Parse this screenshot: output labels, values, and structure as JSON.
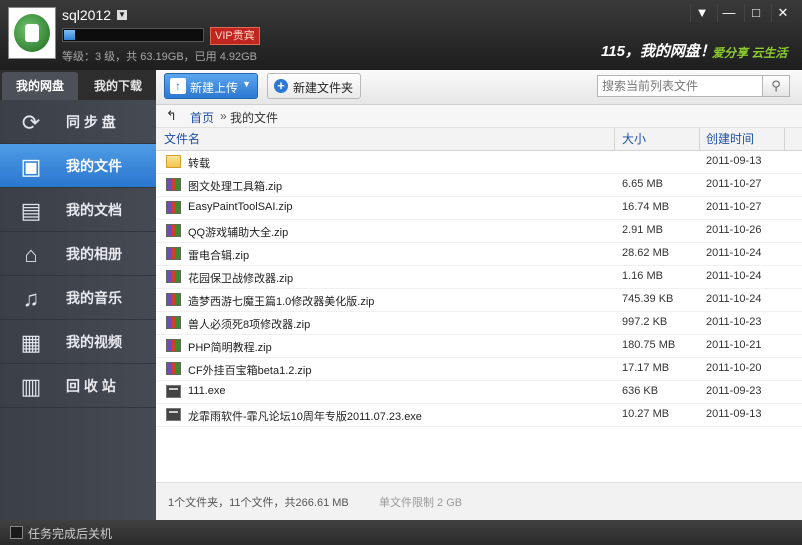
{
  "user": {
    "name": "sql2012",
    "vip_label": "VIP贵宾",
    "level_text": "等级：3 级，共 63.19GB，已用 4.92GB",
    "usage_fraction": 0.078
  },
  "brand": {
    "logo": "115，我的网盘！",
    "slogan": "爱分享 云生活"
  },
  "window_controls": {
    "menu": "▼",
    "minimize": "—",
    "maximize": "□",
    "close": "✕"
  },
  "nav": {
    "tabs": [
      {
        "label": "我的网盘",
        "active": true
      },
      {
        "label": "我的下载",
        "active": false
      }
    ],
    "items": [
      {
        "label": "同 步 盘",
        "icon": "sync-icon",
        "glyph": "⟳",
        "active": false
      },
      {
        "label": "我的文件",
        "icon": "briefcase-icon",
        "glyph": "▣",
        "active": true
      },
      {
        "label": "我的文档",
        "icon": "document-icon",
        "glyph": "▤",
        "active": false
      },
      {
        "label": "我的相册",
        "icon": "photo-album-icon",
        "glyph": "⌂",
        "active": false
      },
      {
        "label": "我的音乐",
        "icon": "music-note-icon",
        "glyph": "♫",
        "active": false
      },
      {
        "label": "我的视频",
        "icon": "film-icon",
        "glyph": "▦",
        "active": false
      },
      {
        "label": "回 收 站",
        "icon": "trash-icon",
        "glyph": "▥",
        "active": false
      }
    ]
  },
  "toolbar": {
    "upload_label": "新建上传",
    "new_folder_label": "新建文件夹",
    "search_placeholder": "搜索当前列表文件"
  },
  "breadcrumb": {
    "home": "首页",
    "separator": "»",
    "current": "我的文件"
  },
  "table": {
    "headers": {
      "name": "文件名",
      "size": "大小",
      "date": "创建时间"
    },
    "rows": [
      {
        "type": "folder",
        "name": "转载",
        "size": "",
        "date": "2011-09-13"
      },
      {
        "type": "zip",
        "name": "图文处理工具箱.zip",
        "size": "6.65 MB",
        "date": "2011-10-27"
      },
      {
        "type": "zip",
        "name": "EasyPaintToolSAI.zip",
        "size": "16.74 MB",
        "date": "2011-10-27"
      },
      {
        "type": "zip",
        "name": "QQ游戏辅助大全.zip",
        "size": "2.91 MB",
        "date": "2011-10-26"
      },
      {
        "type": "zip",
        "name": "雷电合辑.zip",
        "size": "28.62 MB",
        "date": "2011-10-24"
      },
      {
        "type": "zip",
        "name": "花园保卫战修改器.zip",
        "size": "1.16 MB",
        "date": "2011-10-24"
      },
      {
        "type": "zip",
        "name": "造梦西游七魔王篇1.0修改器美化版.zip",
        "size": "745.39 KB",
        "date": "2011-10-24"
      },
      {
        "type": "zip",
        "name": "兽人必须死8项修改器.zip",
        "size": "997.2 KB",
        "date": "2011-10-23"
      },
      {
        "type": "zip",
        "name": "PHP简明教程.zip",
        "size": "180.75 MB",
        "date": "2011-10-21"
      },
      {
        "type": "zip",
        "name": "CF外挂百宝箱beta1.2.zip",
        "size": "17.17 MB",
        "date": "2011-10-20"
      },
      {
        "type": "exe",
        "name": "111.exe",
        "size": "636 KB",
        "date": "2011-09-23"
      },
      {
        "type": "exe",
        "name": "龙霏雨软件-霏凡论坛10周年专版2011.07.23.exe",
        "size": "10.27 MB",
        "date": "2011-09-13"
      }
    ]
  },
  "footer": {
    "summary": "1个文件夹，11个文件，共266.61 MB",
    "limit": "单文件限制 2 GB"
  },
  "bottom": {
    "shutdown_label": "任务完成后关机"
  }
}
